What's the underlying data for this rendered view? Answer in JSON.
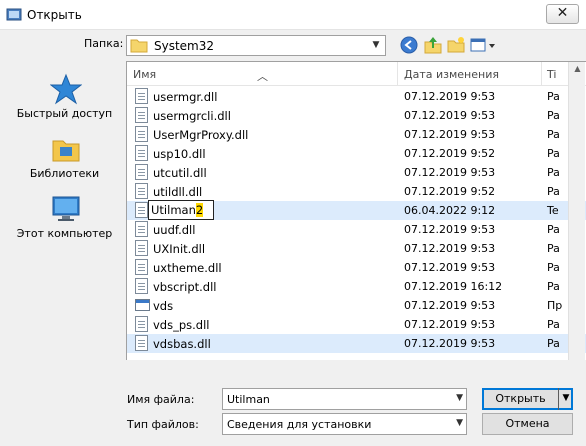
{
  "window": {
    "title": "Открыть",
    "close_label": "✕"
  },
  "location": {
    "label": "Папка:",
    "value": "System32"
  },
  "places": [
    {
      "label": "Быстрый доступ",
      "icon": "star-icon"
    },
    {
      "label": "Библиотеки",
      "icon": "libraries-icon"
    },
    {
      "label": "Этот компьютер",
      "icon": "computer-icon"
    }
  ],
  "columns": {
    "name": "Имя",
    "date": "Дата изменения",
    "type": "Ti"
  },
  "files": [
    {
      "name": "usermgr.dll",
      "date": "07.12.2019 9:53",
      "type": "Pa",
      "icon": "dll-icon"
    },
    {
      "name": "usermgrcli.dll",
      "date": "07.12.2019 9:53",
      "type": "Pa",
      "icon": "dll-icon"
    },
    {
      "name": "UserMgrProxy.dll",
      "date": "07.12.2019 9:53",
      "type": "Pa",
      "icon": "dll-icon"
    },
    {
      "name": "usp10.dll",
      "date": "07.12.2019 9:52",
      "type": "Pa",
      "icon": "dll-icon"
    },
    {
      "name": "utcutil.dll",
      "date": "07.12.2019 9:53",
      "type": "Pa",
      "icon": "dll-icon"
    },
    {
      "name": "utildll.dll",
      "date": "07.12.2019 9:52",
      "type": "Pa",
      "icon": "dll-icon"
    },
    {
      "name": "Utilman2",
      "date": "06.04.2022 9:12",
      "type": "Te",
      "icon": "file-icon"
    },
    {
      "name": "uudf.dll",
      "date": "07.12.2019 9:53",
      "type": "Pa",
      "icon": "dll-icon"
    },
    {
      "name": "UXInit.dll",
      "date": "07.12.2019 9:53",
      "type": "Pa",
      "icon": "dll-icon"
    },
    {
      "name": "uxtheme.dll",
      "date": "07.12.2019 9:53",
      "type": "Pa",
      "icon": "dll-icon"
    },
    {
      "name": "vbscript.dll",
      "date": "07.12.2019 16:12",
      "type": "Pa",
      "icon": "dll-icon"
    },
    {
      "name": "vds",
      "date": "07.12.2019 9:53",
      "type": "Пр",
      "icon": "exe-icon"
    },
    {
      "name": "vds_ps.dll",
      "date": "07.12.2019 9:53",
      "type": "Pa",
      "icon": "dll-icon"
    },
    {
      "name": "vdsbas.dll",
      "date": "07.12.2019 9:53",
      "type": "Pa",
      "icon": "dll-icon"
    }
  ],
  "rename": {
    "base": "Utilman",
    "selected": "2"
  },
  "filename": {
    "label": "Имя файла:",
    "value": "Utilman"
  },
  "filetype": {
    "label": "Тип файлов:",
    "value": "Сведения для установки"
  },
  "buttons": {
    "open": "Открыть",
    "cancel": "Отмена"
  },
  "colors": {
    "selection": "#dcebfc",
    "accent": "#0078d7"
  }
}
